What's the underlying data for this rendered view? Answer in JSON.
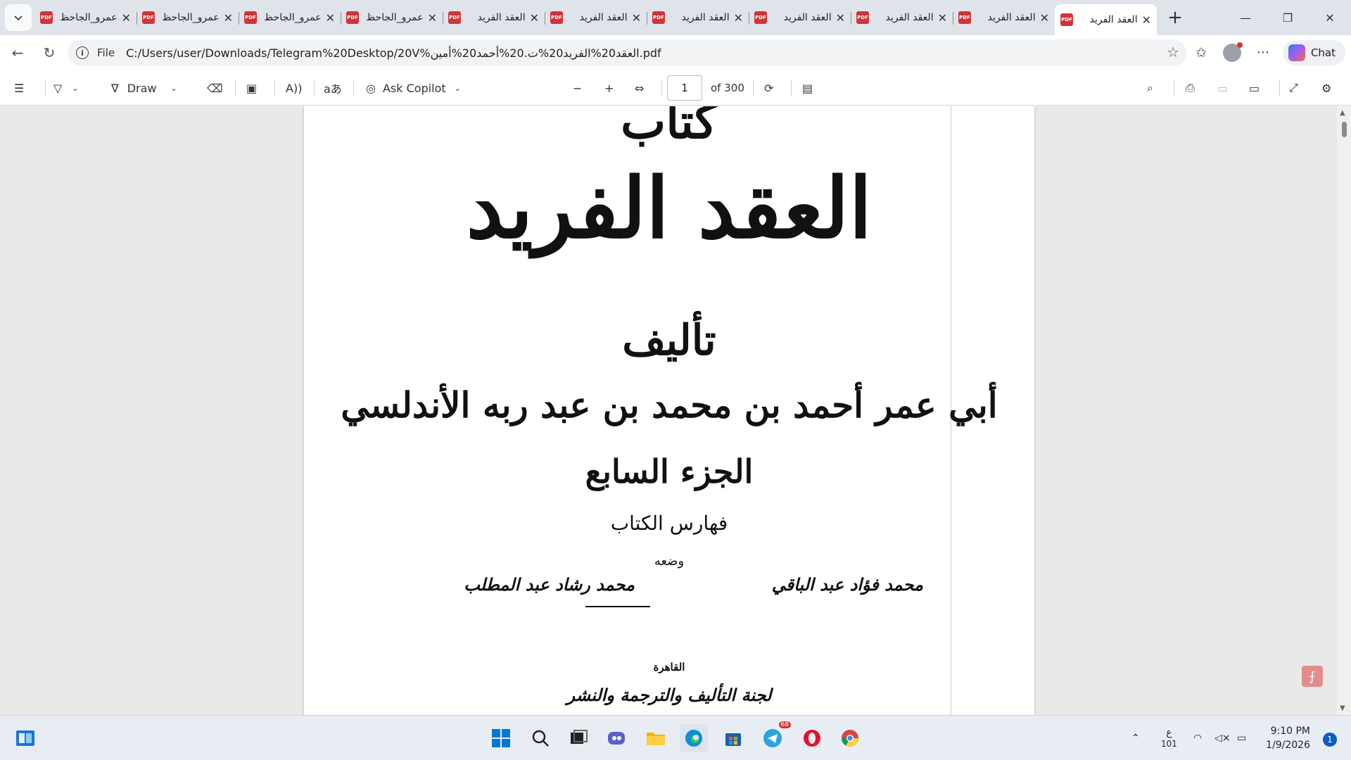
{
  "tabs": [
    {
      "title": "عمرو_الجاحظ"
    },
    {
      "title": "عمرو_الجاحظ"
    },
    {
      "title": "عمرو_الجاحظ"
    },
    {
      "title": "عمرو_الجاحظ"
    },
    {
      "title": "العقد الفريد"
    },
    {
      "title": "العقد الفريد"
    },
    {
      "title": "العقد الفريد"
    },
    {
      "title": "العقد الفريد"
    },
    {
      "title": "العقد الفريد"
    },
    {
      "title": "العقد الفريد"
    },
    {
      "title": "العقد الفريد",
      "active": true
    }
  ],
  "address": {
    "scheme_label": "File",
    "url": "C:/Users/user/Downloads/Telegram%20Desktop/20V%العقد20%الفريد20%ت.20%أحمد20%أمين.pdf"
  },
  "right_toolbar": {
    "chat_label": "Chat"
  },
  "pdf_toolbar": {
    "draw_label": "Draw",
    "copilot_label": "Ask Copilot",
    "page_current": "1",
    "page_total_label": "of 300"
  },
  "document": {
    "kitab": "كتاب",
    "title": "العقد الفريد",
    "talif": "تأليف",
    "author": "أبي عمر أحمد بن محمد بن عبد ربه الأندلسي",
    "part": "الجزء السابع",
    "subtitle": "فهارس الكتاب",
    "compiled_by": "وضعه",
    "editor_1": "محمد فؤاد عبد الباقي",
    "editor_2": "محمد رشاد عبد المطلب",
    "city": "القاهرة",
    "publisher": "لجنة التأليف والترجمة والنشر"
  },
  "taskbar": {
    "language_label": "ع",
    "language_sub": "101",
    "telegram_badge": "68",
    "time": "9:10 PM",
    "date": "1/9/2026",
    "notifications": "1"
  },
  "icons": {
    "tab_menu": "chevron-down-icon",
    "pdf": "pdf-file-icon",
    "close": "close-icon",
    "new_tab": "plus-icon"
  },
  "colors": {
    "pdf_badge": "#d13438",
    "accent": "#0a5dc2"
  }
}
